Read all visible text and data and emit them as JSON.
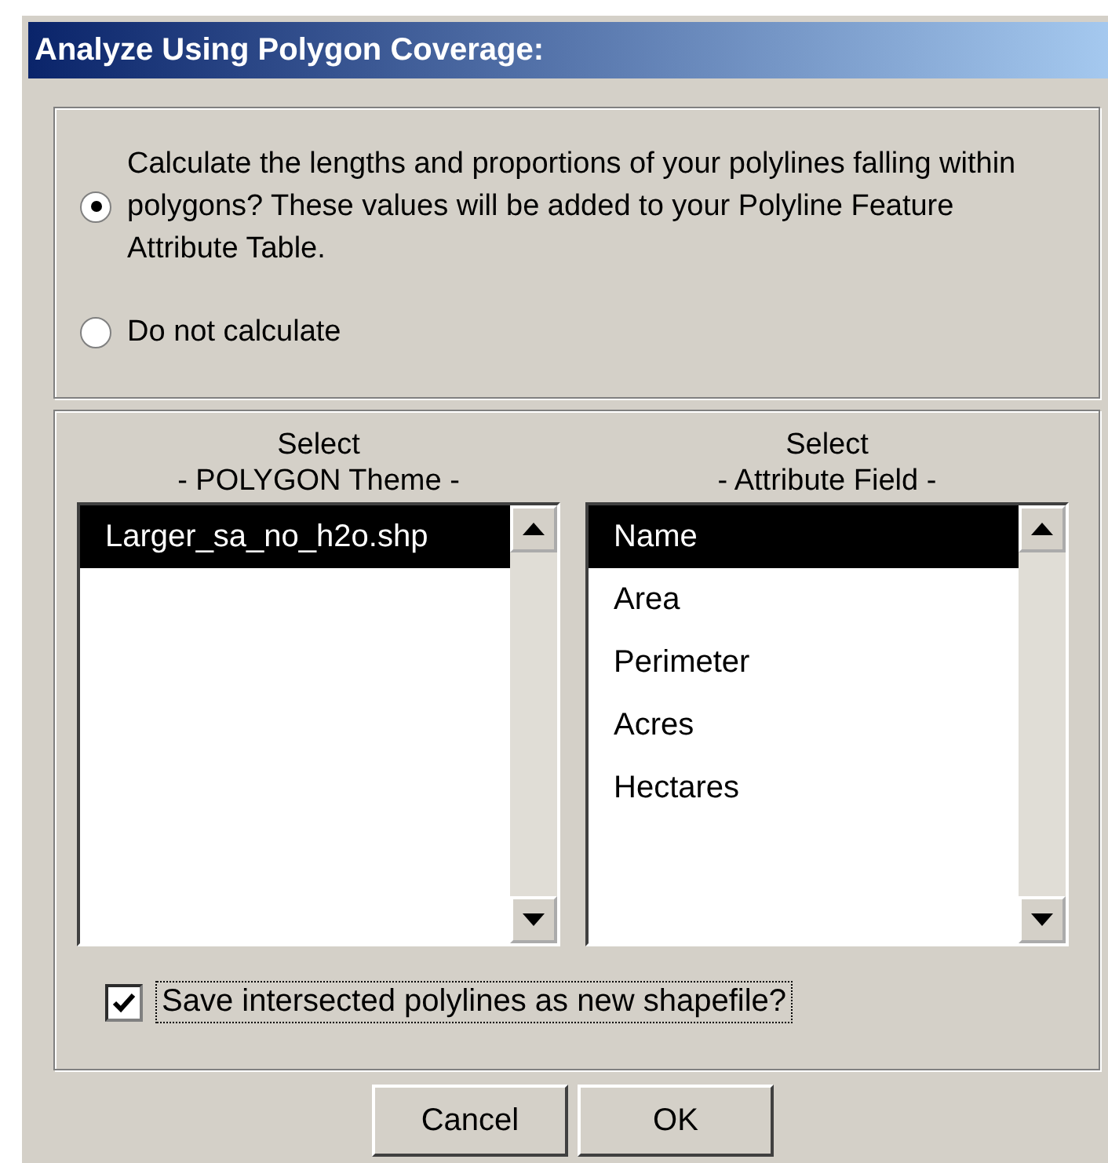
{
  "window": {
    "title": "Analyze Using Polygon Coverage:"
  },
  "options": [
    {
      "label": "Calculate the lengths and proportions of your polylines falling within polygons?  These values will be added to your Polyline Feature Attribute Table.",
      "selected": true
    },
    {
      "label": "Do not calculate",
      "selected": false
    }
  ],
  "lists": [
    {
      "heading": "Select",
      "subheading": "- POLYGON Theme -",
      "items": [
        {
          "label": "Larger_sa_no_h2o.shp",
          "selected": true
        }
      ]
    },
    {
      "heading": "Select",
      "subheading": "- Attribute Field -",
      "items": [
        {
          "label": "Name",
          "selected": true
        },
        {
          "label": "Area",
          "selected": false
        },
        {
          "label": "Perimeter",
          "selected": false
        },
        {
          "label": "Acres",
          "selected": false
        },
        {
          "label": "Hectares",
          "selected": false
        }
      ]
    }
  ],
  "save_checkbox": {
    "label": "Save intersected polylines as new shapefile?",
    "checked": true
  },
  "buttons": [
    "Cancel",
    "OK"
  ]
}
